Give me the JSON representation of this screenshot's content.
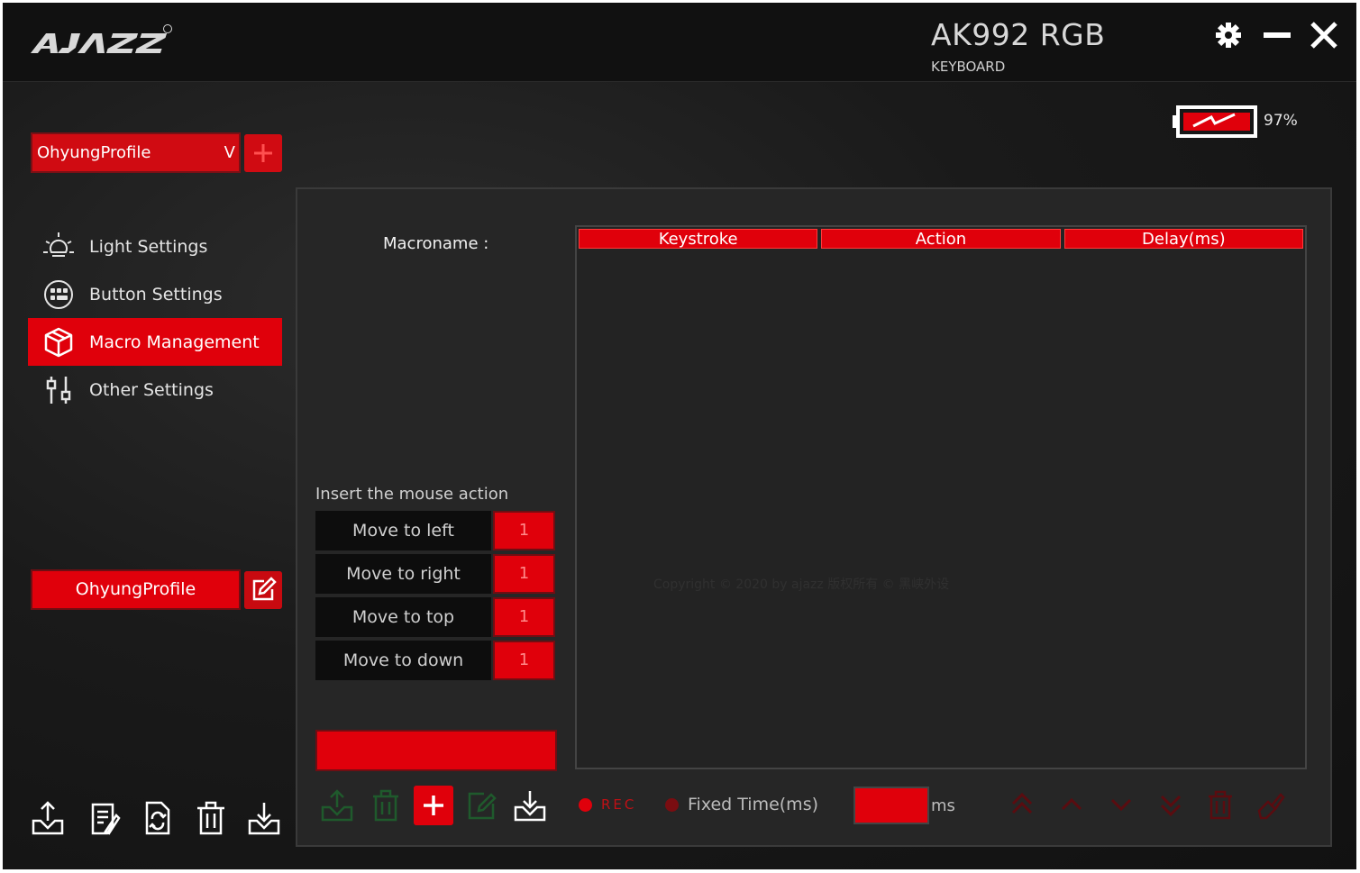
{
  "app": {
    "brand": "AJAZZ",
    "model": "AK992 RGB",
    "device_type": "KEYBOARD",
    "battery": {
      "percent": "97%",
      "level": 0.97
    },
    "window_controls": [
      "gear-icon",
      "minimize-icon",
      "close-icon"
    ]
  },
  "sidebar": {
    "profile_select": {
      "value": "OhyungProfile",
      "chevron": "V"
    },
    "items": [
      {
        "label": "Light Settings",
        "icon": "light-bulb-icon",
        "active": false
      },
      {
        "label": "Button Settings",
        "icon": "keyboard-keys-icon",
        "active": false
      },
      {
        "label": "Macro Management",
        "icon": "macro-box-icon",
        "active": true
      },
      {
        "label": "Other Settings",
        "icon": "sliders-icon",
        "active": false
      }
    ],
    "profile_name": "OhyungProfile",
    "footer_icons": [
      "export-icon",
      "notes-icon",
      "refresh-file-icon",
      "trash-icon",
      "import-icon"
    ]
  },
  "macro": {
    "name_label": "Macroname :",
    "columns": [
      "Keystroke",
      "Action",
      "Delay(ms)"
    ],
    "copyright": "Copyright © 2020 by ajazz 版权所有 © 黑峡外设",
    "insert_label": "Insert the mouse action",
    "mouse_actions": [
      {
        "label": "Move to left",
        "value": "1"
      },
      {
        "label": "Move to right",
        "value": "1"
      },
      {
        "label": "Move to top",
        "value": "1"
      },
      {
        "label": "Move to down",
        "value": "1"
      }
    ],
    "rec_label": "REC",
    "fixed_time_label": "Fixed Time(ms)",
    "ms_value": "",
    "ms_unit": "ms"
  },
  "colors": {
    "accent": "#e0000b",
    "background": "#1a1a1a",
    "panel": "#262626"
  }
}
